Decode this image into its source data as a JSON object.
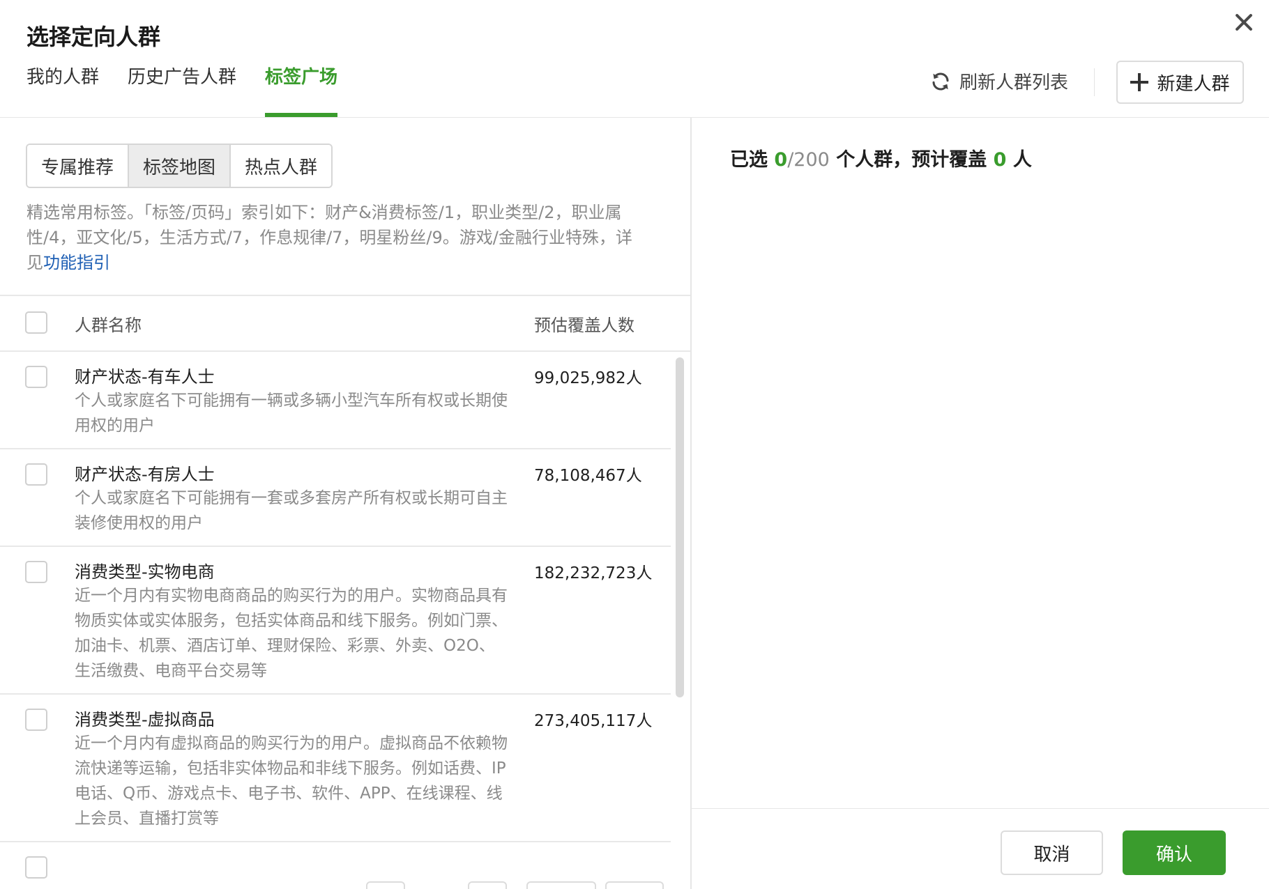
{
  "dialog": {
    "title": "选择定向人群"
  },
  "tabs": [
    {
      "label": "我的人群"
    },
    {
      "label": "历史广告人群"
    },
    {
      "label": "标签广场"
    }
  ],
  "header_actions": {
    "refresh_label": "刷新人群列表",
    "new_label": "新建人群"
  },
  "segments": [
    {
      "label": "专属推荐"
    },
    {
      "label": "标签地图"
    },
    {
      "label": "热点人群"
    }
  ],
  "description": {
    "text": "精选常用标签。「标签/页码」索引如下：财产&消费标签/1，职业类型/2，职业属性/4，亚文化/5，生活方式/7，作息规律/7，明星粉丝/9。游戏/金融行业特殊，详见",
    "link": "功能指引"
  },
  "table": {
    "col_name": "人群名称",
    "col_count": "预估覆盖人数",
    "rows": [
      {
        "name": "财产状态-有车人士",
        "desc": "个人或家庭名下可能拥有一辆或多辆小型汽车所有权或长期使用权的用户",
        "count": "99,025,982人"
      },
      {
        "name": "财产状态-有房人士",
        "desc": "个人或家庭名下可能拥有一套或多套房产所有权或长期可自主装修使用权的用户",
        "count": "78,108,467人"
      },
      {
        "name": "消费类型-实物电商",
        "desc": "近一个月内有实物电商商品的购买行为的用户。实物商品具有物质实体或实体服务，包括实体商品和线下服务。例如门票、加油卡、机票、酒店订单、理财保险、彩票、外卖、O2O、生活缴费、电商平台交易等",
        "count": "182,232,723人"
      },
      {
        "name": "消费类型-虚拟商品",
        "desc": "近一个月内有虚拟商品的购买行为的用户。虚拟商品不依赖物流快递等运输，包括非实体物品和非线下服务。例如话费、IP电话、Q币、游戏点卡、电子书、软件、APP、在线课程、线上会员、直播打赏等",
        "count": "273,405,117人"
      }
    ]
  },
  "summary": {
    "prefix": "已选",
    "selected": "0",
    "limit": "/200",
    "middle": "个人群，预计覆盖",
    "coverage": "0",
    "suffix": "人"
  },
  "footer": {
    "cancel_label": "取消",
    "confirm_label": "确认"
  },
  "colors": {
    "accent": "#3a9c2d",
    "link": "#1e5fb4"
  },
  "icons": {
    "close": "close-icon",
    "refresh": "refresh-icon",
    "plus": "plus-icon"
  }
}
